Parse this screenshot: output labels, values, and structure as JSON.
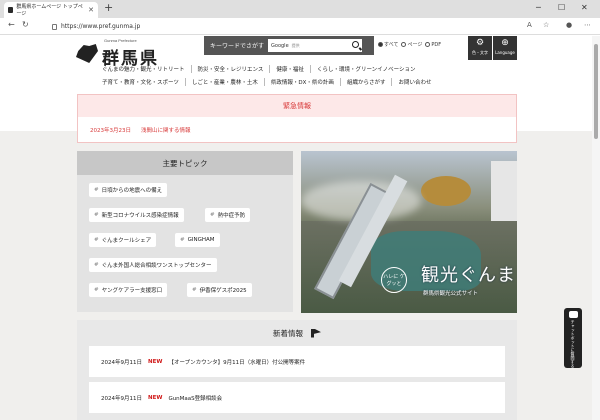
{
  "browser": {
    "tab_title": "群馬県ホームページ トップページ",
    "new_tab": "+",
    "url": "https://www.pref.gunma.jp",
    "window_controls": [
      "─",
      "☐",
      "✕"
    ]
  },
  "header": {
    "logo_small": "Gunma Prefecture",
    "logo_title": "群馬県",
    "search_label": "キーワードでさがす",
    "search_engine": "Google",
    "search_placeholder": "提供",
    "radio_all": "すべて",
    "radio_page": "ページ",
    "radio_pdf": "PDF",
    "color_btn": "色・文字",
    "lang_btn": "Language"
  },
  "nav": {
    "row1": [
      "ぐんまの魅力・観光・リトリート",
      "防災・安全・レジリエンス",
      "健康・福祉",
      "くらし・環境・グリーンイノベーション"
    ],
    "row2": [
      "子育て・教育・文化・スポーツ",
      "しごと・産業・農林・土木",
      "県政情報・DX・県の計画",
      "組織からさがす",
      "お問い合わせ"
    ]
  },
  "emergency": {
    "heading": "緊急情報",
    "date": "2023年3月23日",
    "link": "浅間山に関する情報"
  },
  "topics": {
    "heading": "主要トピック",
    "chips": [
      "日頃からの地震への備え",
      "新型コロナウイルス感染症情報",
      "熱中症予防",
      "ぐんまクールシェア",
      "GINGHAM",
      "ぐんま外国人総合相談ワンストップセンター",
      "ヤングケアラー支援窓口",
      "伊香保ゲスポ2025"
    ],
    "hash": "#"
  },
  "promo": {
    "small": "ハレに ケグッと",
    "title": "観光ぐんま",
    "sub": "群馬県観光公式サイト"
  },
  "news": {
    "heading": "新着情報",
    "items": [
      {
        "date": "2024年9月11日",
        "badge": "NEW",
        "text": "【オープンカウンタ】9月11日（水曜日）付公開等案件"
      },
      {
        "date": "2024年9月11日",
        "badge": "NEW",
        "text": "GunMaaS登録相談会"
      }
    ]
  },
  "side": {
    "label": "チャットボットに質問する"
  }
}
